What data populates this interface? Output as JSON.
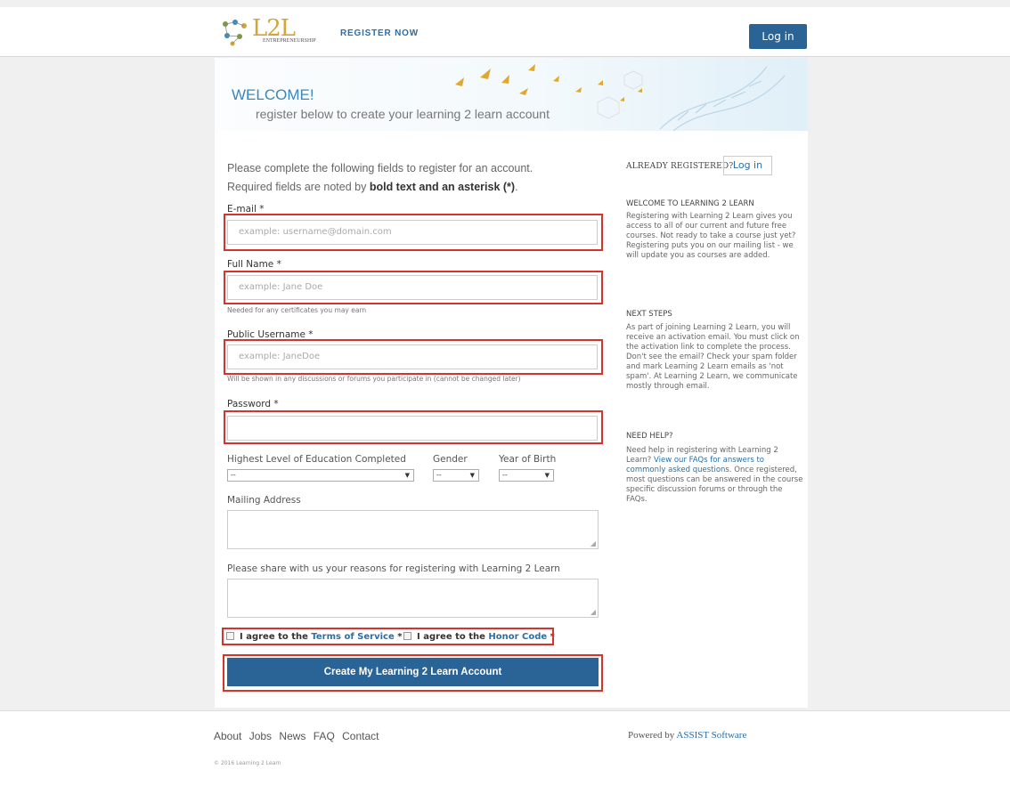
{
  "header": {
    "logo_text": "L2L",
    "logo_sub": "ENTREPRENEURSHIP",
    "register_now": "REGISTER NOW",
    "login_button": "Log in"
  },
  "banner": {
    "welcome": "WELCOME!",
    "subtitle": "register below to create your learning 2 learn account"
  },
  "intro": {
    "line1": "Please complete the following fields to register for an account.",
    "line2_prefix": "Required fields are noted by ",
    "line2_bold": "bold text and an asterisk (*)",
    "line2_suffix": "."
  },
  "form": {
    "email": {
      "label": "E-mail *",
      "placeholder": "example: username@domain.com"
    },
    "full_name": {
      "label": "Full Name *",
      "placeholder": "example: Jane Doe",
      "hint": "Needed for any certificates you may earn"
    },
    "username": {
      "label": "Public Username *",
      "placeholder": "example: JaneDoe",
      "hint": "Will be shown in any discussions or forums you participate in (cannot be changed later)"
    },
    "password": {
      "label": "Password *",
      "placeholder": ""
    },
    "education": {
      "label": "Highest Level of Education Completed",
      "value": "--"
    },
    "gender": {
      "label": "Gender",
      "value": "--"
    },
    "year_of_birth": {
      "label": "Year of Birth",
      "value": "--"
    },
    "mailing_address": {
      "label": "Mailing Address"
    },
    "reasons": {
      "label": "Please share with us your reasons for registering with Learning 2 Learn"
    },
    "terms": {
      "prefix": "I agree to the ",
      "link": "Terms of Service",
      "suffix": " *"
    },
    "honor": {
      "prefix": "I agree to the ",
      "link": "Honor Code",
      "suffix": " *"
    },
    "submit": "Create My Learning 2 Learn Account"
  },
  "sidebar": {
    "already_registered": "ALREADY REGISTERED?",
    "login_button": "Log in",
    "welcome_title": "WELCOME TO LEARNING 2 LEARN",
    "welcome_text": "Registering with Learning 2 Learn gives you access to all of our current and future free courses. Not ready to take a course just yet? Registering puts you on our mailing list - we will update you as courses are added.",
    "next_title": "NEXT STEPS",
    "next_text": "As part of joining Learning 2 Learn, you will receive an activation email. You must click on the activation link to complete the process. Don't see the email? Check your spam folder and mark Learning 2 Learn emails as 'not spam'. At Learning 2 Learn, we communicate mostly through email.",
    "help_title": "NEED HELP?",
    "help_prefix": "Need help in registering with Learning 2 Learn? ",
    "help_link": "View our FAQs for answers to commonly asked questions.",
    "help_suffix": " Once registered, most questions can be answered in the course specific discussion forums or through the FAQs."
  },
  "footer": {
    "links": [
      "About",
      "Jobs",
      "News",
      "FAQ",
      "Contact"
    ],
    "copyright": "© 2016 Learning 2 Learn",
    "powered_prefix": "Powered by ",
    "powered_link": "ASSIST Software"
  },
  "colors": {
    "accent": "#2a6496",
    "link": "#2a6fa8",
    "highlight": "#d6342b",
    "logo_gold": "#d4a43b"
  }
}
